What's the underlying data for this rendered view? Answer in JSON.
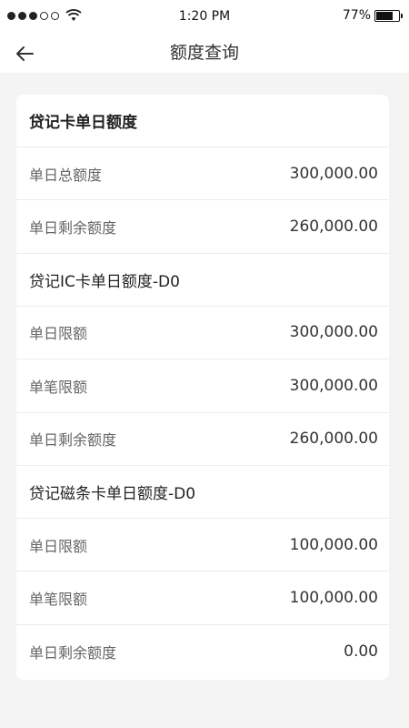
{
  "status_bar": {
    "time": "1:20 PM",
    "battery": "77%",
    "battery_level": 0.77
  },
  "nav": {
    "title": "额度查询",
    "back_icon": "arrow-left-icon"
  },
  "sections": [
    {
      "title": "贷记卡单日额度",
      "rows": [
        {
          "label": "单日总额度",
          "value": "300,000.00"
        },
        {
          "label": "单日剩余额度",
          "value": "260,000.00"
        }
      ]
    },
    {
      "title": "贷记IC卡单日额度-D0",
      "rows": [
        {
          "label": "单日限额",
          "value": "300,000.00"
        },
        {
          "label": "单笔限额",
          "value": "300,000.00"
        },
        {
          "label": "单日剩余额度",
          "value": "260,000.00"
        }
      ]
    },
    {
      "title": "贷记磁条卡单日额度-D0",
      "rows": [
        {
          "label": "单日限额",
          "value": "100,000.00"
        },
        {
          "label": "单笔限额",
          "value": "100,000.00"
        },
        {
          "label": "单日剩余额度",
          "value": "0.00"
        }
      ]
    }
  ]
}
